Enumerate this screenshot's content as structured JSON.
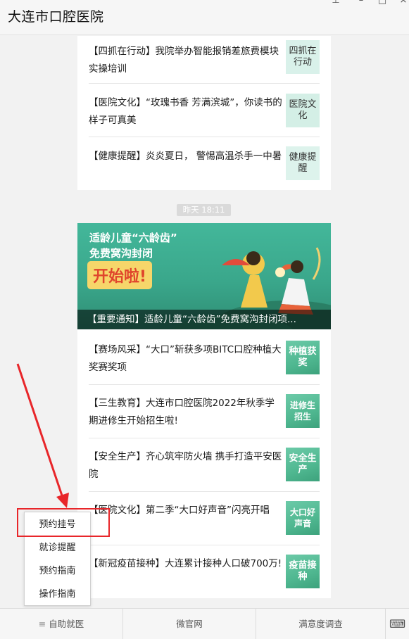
{
  "window": {
    "title": "大连市口腔医院"
  },
  "articles_top": [
    {
      "title": "【四抓在行动】我院举办智能报销差旅费模块实操培训",
      "thumb": "四抓在行动"
    },
    {
      "title": "【医院文化】“玫瑰书香 芳满滨城”，你读书的样子可真美",
      "thumb": "医院文化"
    },
    {
      "title": "【健康提醒】炎炎夏日， 警惕高温杀手一中暑",
      "thumb": "健康提醒"
    }
  ],
  "timestamp": "昨天 18:11",
  "banner": {
    "line1": "适龄儿童“六龄齿”",
    "line2": "免费窝沟封闭",
    "line3": "开始啦!",
    "caption": "【重要通知】适龄儿童“六龄齿”免费窝沟封闭项..."
  },
  "articles_bottom": [
    {
      "title": "【赛场风采】“大口”斩获多项BITC口腔种植大奖赛奖项",
      "thumb": "种植获奖"
    },
    {
      "title": "【三生教育】大连市口腔医院2022年秋季学期进修生开始招生啦!",
      "thumb": "进修生招生"
    },
    {
      "title": "【安全生产】齐心筑牢防火墙  携手打造平安医院",
      "thumb": "安全生产"
    },
    {
      "title": "【医院文化】第二季“大口好声音”闪亮开唱",
      "thumb": "大口好声音"
    },
    {
      "title": "【新冠疫苗接种】大连累计接种人口破700万!",
      "thumb": "疫苗接种"
    }
  ],
  "popup_menu": [
    "预约挂号",
    "就诊提醒",
    "预约指南",
    "操作指南"
  ],
  "bottom_menu": {
    "tab1": "自助就医",
    "tab2": "微官网",
    "tab3": "满意度调查"
  },
  "colors": {
    "highlight_box": "#e8262a",
    "annotation_arrow": "#e8262a",
    "banner_green": "#3aa78b"
  },
  "icons": {
    "pin": "pin-icon",
    "minimize": "minimize-icon",
    "maximize": "maximize-icon",
    "close": "close-icon",
    "menu": "menu-lines-icon",
    "keyboard": "keyboard-icon"
  }
}
